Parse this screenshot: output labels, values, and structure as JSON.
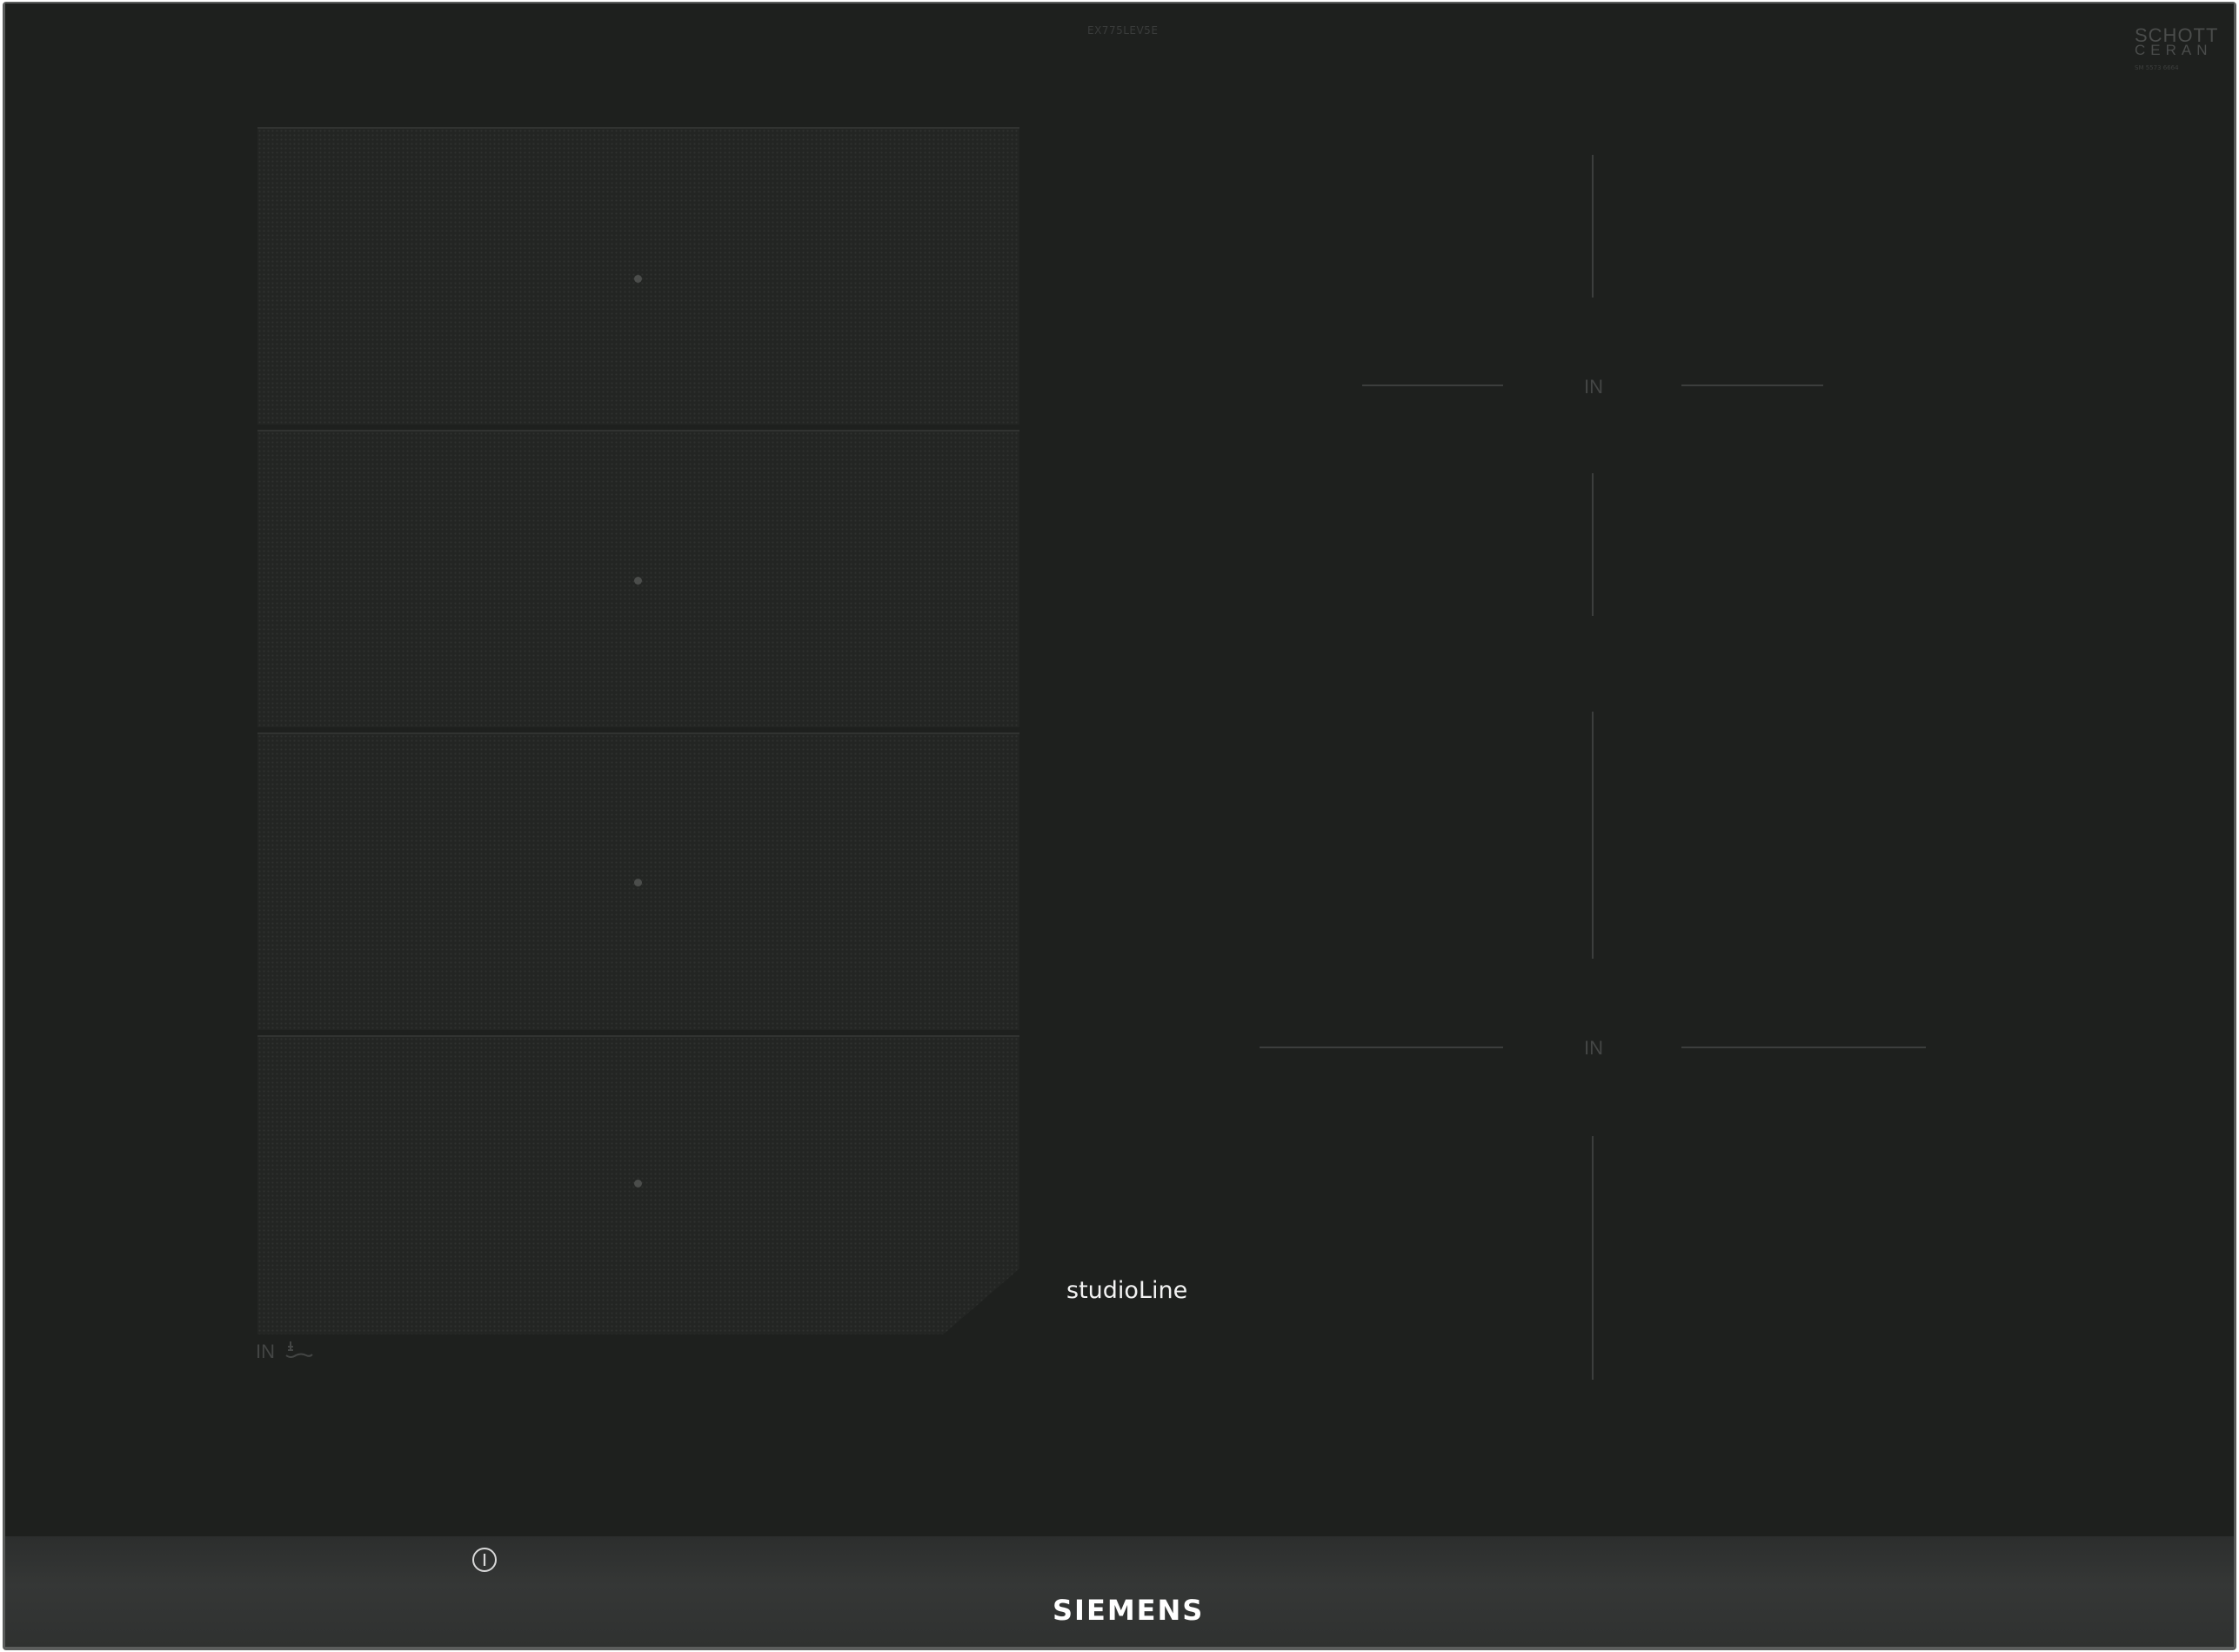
{
  "hob": {
    "model_code": "EX775LEV5E",
    "schott_logo": {
      "line1": "SCHOTT",
      "line2": "CERAN",
      "code": "SM 5573 6664"
    },
    "flex_zone": {
      "zone_count": 4,
      "label": "IN"
    },
    "right_zones": {
      "upper_label": "IN",
      "lower_label": "IN"
    },
    "series_name": "studioLine",
    "power_icon": "power-info-icon",
    "brand": "SIEMENS",
    "colors": {
      "glass": "#1e201e",
      "frame": "#5b5d5c",
      "marking": "#3c3e3d",
      "text_light": "#f2f2f2"
    }
  }
}
